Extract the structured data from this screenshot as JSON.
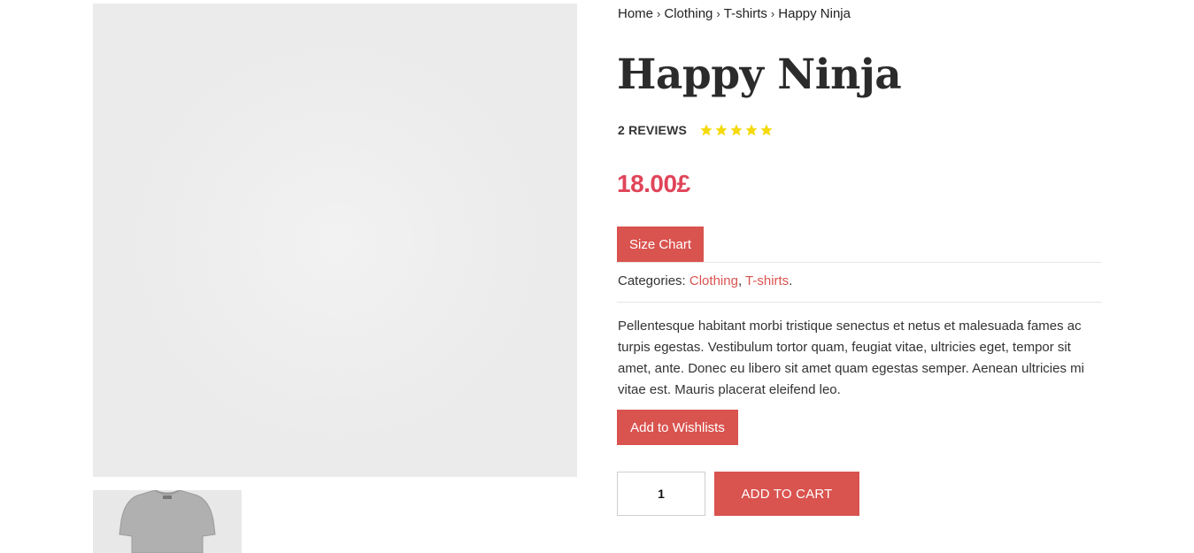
{
  "breadcrumb": {
    "items": [
      "Home",
      "Clothing",
      "T-shirts"
    ],
    "current": "Happy Ninja",
    "separator": "›"
  },
  "product": {
    "title": "Happy Ninja",
    "reviews_label": "2 REVIEWS",
    "rating": 5,
    "rating_max": 5,
    "price": "18.00£",
    "categories_label": "Categories:",
    "categories": [
      "Clothing",
      "T-shirts"
    ],
    "description": "Pellentesque habitant morbi tristique senectus et netus et malesuada fames ac turpis egestas. Vestibulum tortor quam, feugiat vitae, ultricies eget, tempor sit amet, ante. Donec eu libero sit amet quam egestas semper. Aenean ultricies mi vitae est. Mauris placerat eleifend leo.",
    "quantity": "1"
  },
  "buttons": {
    "size_chart": "Size Chart",
    "wishlist": "Add to Wishlists",
    "add_to_cart": "ADD TO CART"
  },
  "colors": {
    "accent": "#d9534f",
    "price": "#e0455a",
    "star": "#f5d90a",
    "shirt": "#b3b3b3"
  }
}
